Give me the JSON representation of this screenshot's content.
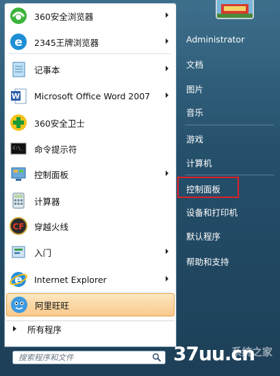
{
  "left_items": [
    {
      "label": "360安全浏览器",
      "icon": "360-browser-icon",
      "arrow": true
    },
    {
      "label": "2345王牌浏览器",
      "icon": "2345-browser-icon",
      "arrow": true
    },
    {
      "label": "记事本",
      "icon": "notepad-icon",
      "arrow": true
    },
    {
      "label": "Microsoft Office Word 2007",
      "icon": "word-icon",
      "arrow": true
    },
    {
      "label": "360安全卫士",
      "icon": "360-safe-icon",
      "arrow": false
    },
    {
      "label": "命令提示符",
      "icon": "cmd-icon",
      "arrow": false
    },
    {
      "label": "控制面板",
      "icon": "control-panel-icon",
      "arrow": true
    },
    {
      "label": "计算器",
      "icon": "calculator-icon",
      "arrow": false
    },
    {
      "label": "穿越火线",
      "icon": "crossfire-icon",
      "arrow": false
    },
    {
      "label": "入门",
      "icon": "getting-started-icon",
      "arrow": true
    },
    {
      "label": "Internet Explorer",
      "icon": "ie-icon",
      "arrow": true
    },
    {
      "label": "阿里旺旺",
      "icon": "aliwangwang-icon",
      "arrow": false,
      "highlighted": true
    }
  ],
  "all_programs": "所有程序",
  "search": {
    "placeholder": "搜索程序和文件"
  },
  "right_items": [
    "Administrator",
    "文档",
    "图片",
    "音乐",
    "游戏",
    "计算机",
    "控制面板",
    "设备和打印机",
    "默认程序",
    "帮助和支持"
  ],
  "watermark": "37uu.cn",
  "watermark_sub": "系统之家",
  "colors": {
    "highlight": "#f9c98a",
    "red_box": "#e0202a"
  }
}
